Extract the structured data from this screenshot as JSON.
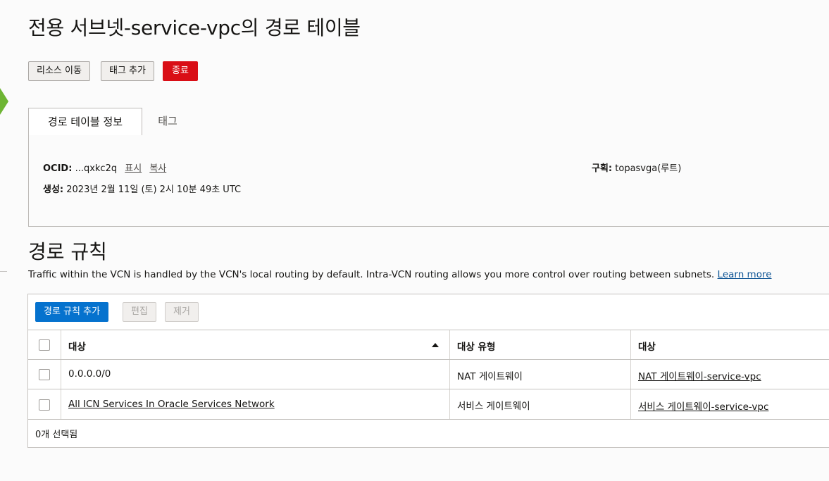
{
  "header": {
    "title": "전용 서브넷-service-vpc의 경로 테이블",
    "buttons": {
      "move_resource": "리소스 이동",
      "add_tags": "태그 추가",
      "terminate": "종료"
    }
  },
  "tabs": [
    {
      "label": "경로 테이블 정보",
      "active": true
    },
    {
      "label": "태그",
      "active": false
    }
  ],
  "info": {
    "ocid_label": "OCID:",
    "ocid_value": "...qxkc2q",
    "show_link": "표시",
    "copy_link": "복사",
    "created_label": "생성:",
    "created_value": "2023년 2월 11일 (토) 2시 10분 49초 UTC",
    "compartment_label": "구획:",
    "compartment_value": "topasvga(루트)"
  },
  "route_rules": {
    "title": "경로 규칙",
    "description": "Traffic within the VCN is handled by the VCN's local routing by default. Intra-VCN routing allows you more control over routing between subnets.",
    "learn_more": "Learn more",
    "toolbar": {
      "add": "경로 규칙 추가",
      "edit": "편집",
      "remove": "제거"
    },
    "columns": [
      "대상",
      "대상 유형",
      "대상"
    ],
    "sort": "ascending",
    "rows": [
      {
        "destination": "0.0.0.0/0",
        "target_type": "NAT 게이트웨이",
        "target": "NAT 게이트웨이-service-vpc",
        "destination_is_link": false
      },
      {
        "destination": "All ICN Services In Oracle Services Network",
        "target_type": "서비스 게이트웨이",
        "target": "서비스 게이트웨이-service-vpc",
        "destination_is_link": true
      }
    ],
    "selected_count": "0개 선택됨"
  },
  "colors": {
    "primary": "#0572ce",
    "danger": "#d90e16",
    "link": "#0f5595",
    "nav_accent": "#6eb534"
  },
  "icons": {
    "sort": "sort-ascending-icon",
    "nav": "nav-arrow-icon"
  }
}
